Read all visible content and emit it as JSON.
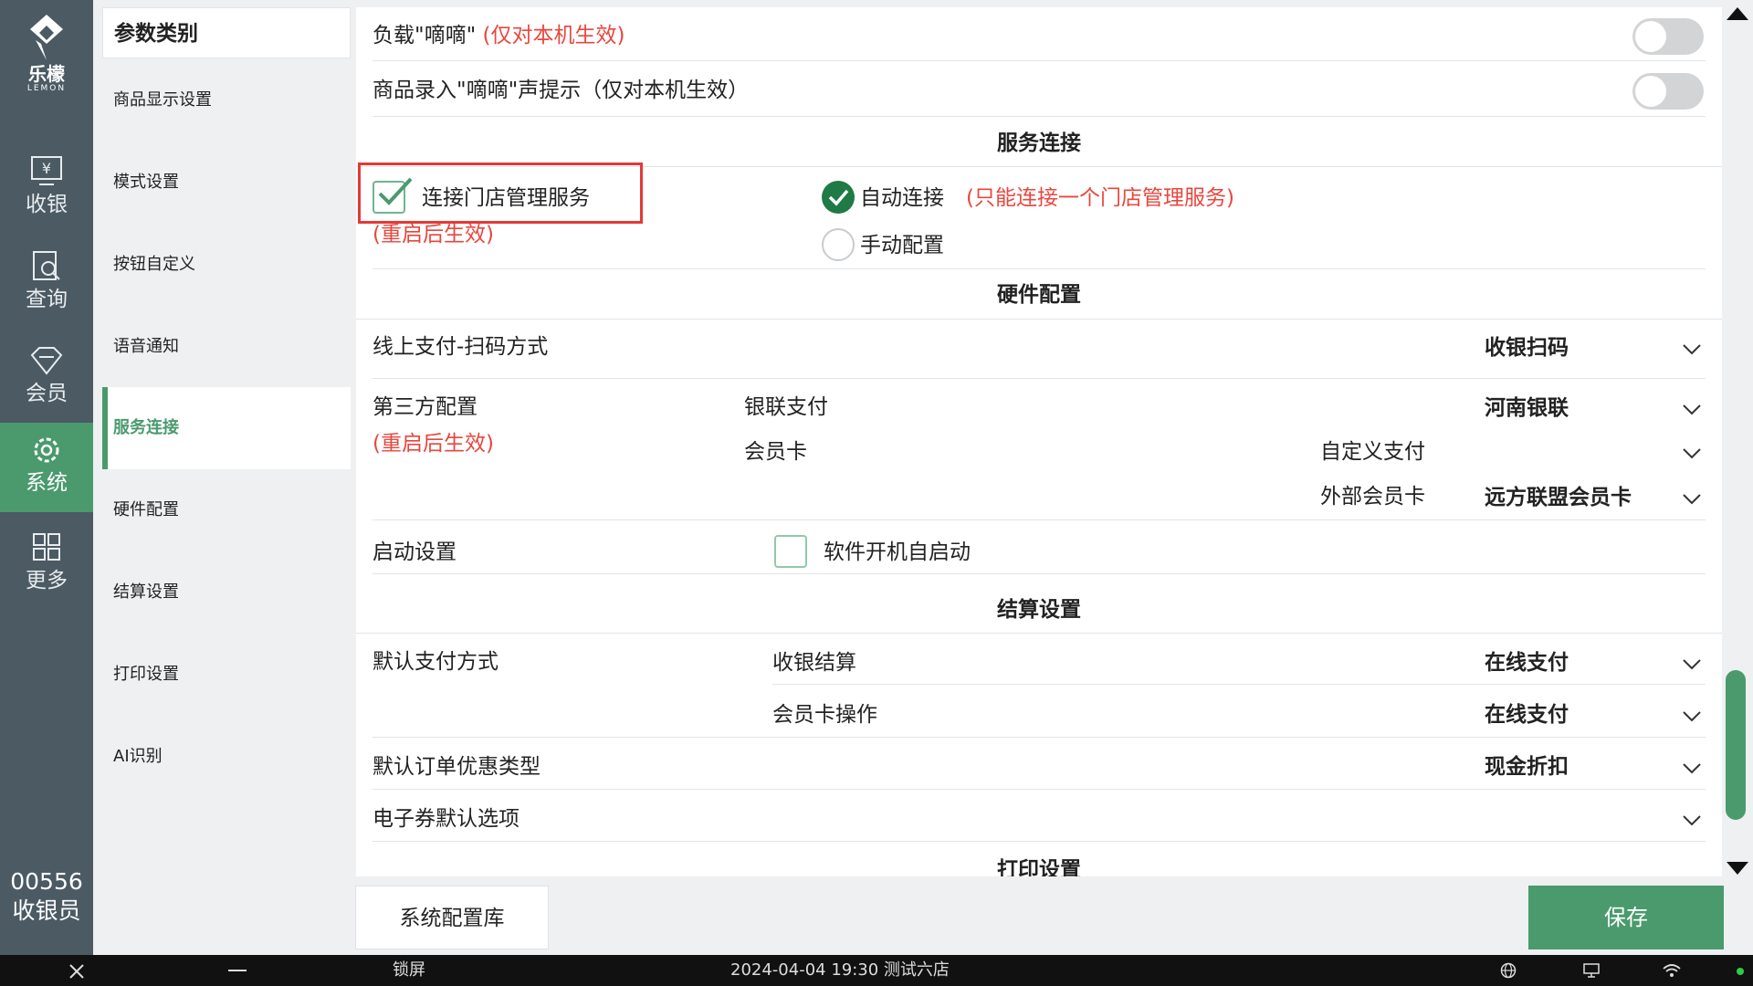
{
  "app": {
    "logo_text": "乐檬",
    "logo_sub": "LEMON"
  },
  "nav": {
    "items": [
      {
        "label": "收银",
        "icon": "cashier-icon"
      },
      {
        "label": "查询",
        "icon": "query-icon"
      },
      {
        "label": "会员",
        "icon": "member-icon"
      },
      {
        "label": "系统",
        "icon": "gear-icon",
        "active": true
      },
      {
        "label": "更多",
        "icon": "grid-icon"
      }
    ],
    "user_id": "00556",
    "user_role": "收银员"
  },
  "categories": {
    "header": "参数类别",
    "items": [
      "商品显示设置",
      "模式设置",
      "按钮自定义",
      "语音通知",
      "服务连接",
      "硬件配置",
      "结算设置",
      "打印设置",
      "AI识别"
    ],
    "active": "服务连接"
  },
  "settings": {
    "beep_load_label": "负载\"嘀嘀\"",
    "beep_load_note": "(仅对本机生效)",
    "beep_entry_label": "商品录入\"嘀嘀\"声提示（仅对本机生效）",
    "service": {
      "title": "服务连接",
      "connect_label": "连接门店管理服务",
      "connect_checked": true,
      "restart_note": "(重启后生效)",
      "auto_label": "自动连接",
      "auto_note": "(只能连接一个门店管理服务)",
      "manual_label": "手动配置"
    },
    "hardware": {
      "title": "硬件配置",
      "online_pay_label": "线上支付-扫码方式",
      "online_pay_value": "收银扫码",
      "third_party_label": "第三方配置",
      "third_party_note": "(重启后生效)",
      "unionpay_label": "银联支付",
      "unionpay_value": "河南银联",
      "member_card_label": "会员卡",
      "custom_pay_label": "自定义支付",
      "custom_pay_value": "",
      "external_card_label": "外部会员卡",
      "external_card_value": "远方联盟会员卡",
      "startup_label": "启动设置",
      "autostart_label": "软件开机自启动"
    },
    "checkout": {
      "title": "结算设置",
      "default_pay_label": "默认支付方式",
      "cashier_checkout_label": "收银结算",
      "cashier_checkout_value": "在线支付",
      "member_card_op_label": "会员卡操作",
      "member_card_op_value": "在线支付",
      "default_discount_label": "默认订单优惠类型",
      "default_discount_value": "现金折扣",
      "ecoupon_label": "电子券默认选项",
      "ecoupon_value": ""
    },
    "print": {
      "title": "打印设置"
    }
  },
  "buttons": {
    "config_lib": "系统配置库",
    "save": "保存"
  },
  "taskbar": {
    "lock": "锁屏",
    "datetime_store": "2024-04-04 19:30 测试六店"
  },
  "colors": {
    "accent": "#4a9a6e",
    "rail": "#4b5a63",
    "note_red": "#e8473e",
    "highlight_box": "#e53935"
  }
}
